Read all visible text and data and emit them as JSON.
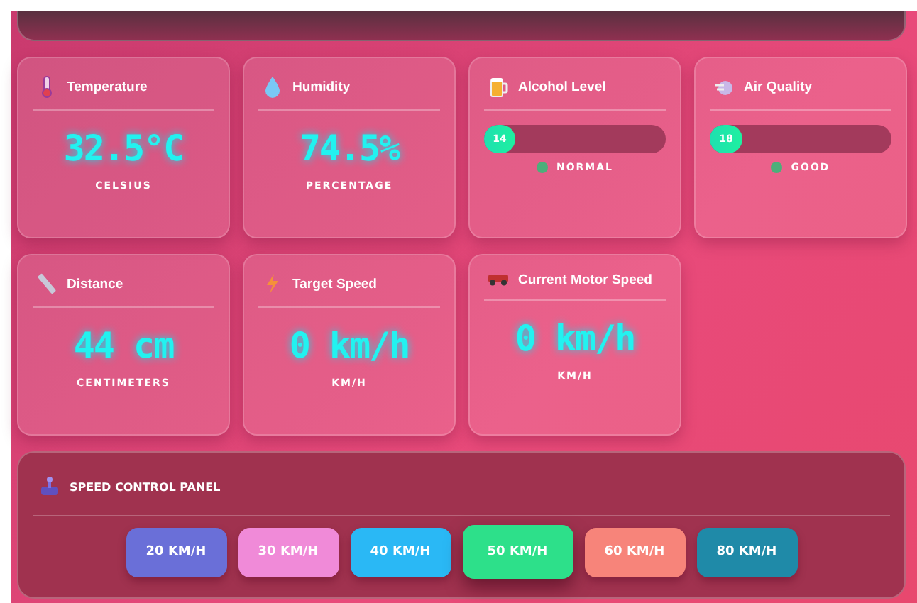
{
  "cards": [
    {
      "kind": "value",
      "title": "Temperature",
      "value": "32.5°C",
      "unit": "CELSIUS"
    },
    {
      "kind": "value",
      "title": "Humidity",
      "value": "74.5%",
      "unit": "PERCENTAGE"
    },
    {
      "kind": "meter",
      "title": "Alcohol Level",
      "reading": "14",
      "level": 0.14,
      "status": "NORMAL"
    },
    {
      "kind": "meter",
      "title": "Air Quality",
      "reading": "18",
      "level": 0.18,
      "status": "GOOD"
    },
    {
      "kind": "value",
      "title": "Distance",
      "value": "44 cm",
      "unit": "CENTIMETERS"
    },
    {
      "kind": "value",
      "title": "Target Speed",
      "value": "0 km/h",
      "unit": "KM/H"
    },
    {
      "kind": "value",
      "title": "Current Motor Speed",
      "value": "0 km/h",
      "unit": "KM/H"
    }
  ],
  "speed_panel": {
    "title": "SPEED CONTROL PANEL",
    "buttons": [
      {
        "label": "20 KM/H",
        "color": "#6a6fd8",
        "selected": false
      },
      {
        "label": "30 KM/H",
        "color": "#f08ad8",
        "selected": false
      },
      {
        "label": "40 KM/H",
        "color": "#2ab8f5",
        "selected": false
      },
      {
        "label": "50 KM/H",
        "color": "#2de08a",
        "selected": true
      },
      {
        "label": "60 KM/H",
        "color": "#f7847a",
        "selected": false
      },
      {
        "label": "80 KM/H",
        "color": "#1f8aa8",
        "selected": false
      }
    ]
  }
}
